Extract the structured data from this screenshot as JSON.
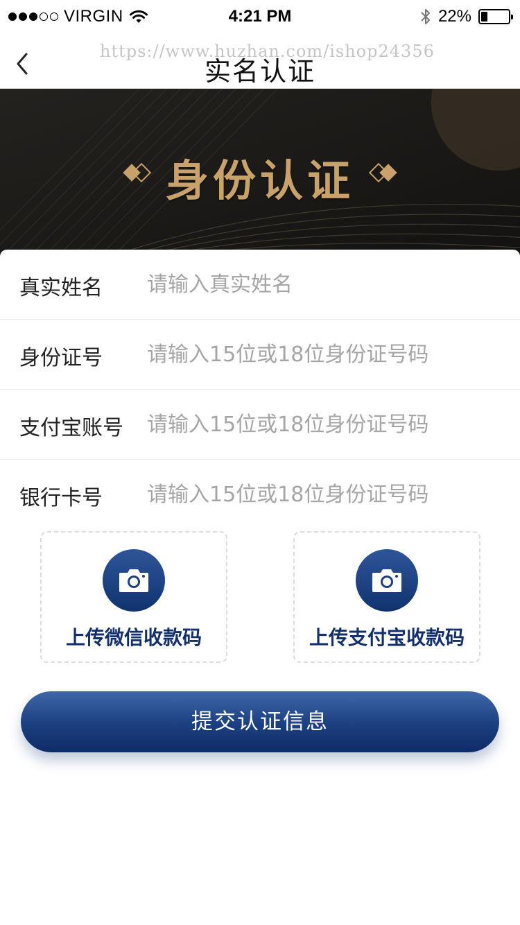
{
  "status_bar": {
    "carrier": "VIRGIN",
    "time": "4:21 PM",
    "battery_percent_text": "22%",
    "battery_level": 0.22,
    "signal_bars_filled": 3,
    "signal_bars_total": 5
  },
  "nav": {
    "title": "实名认证",
    "watermark": "https://www.huzhan.com/ishop24356"
  },
  "banner": {
    "title": "身份认证",
    "accent_color": "#c8a26a"
  },
  "form": {
    "rows": [
      {
        "label": "真实姓名",
        "placeholder": "请输入真实姓名"
      },
      {
        "label": "身份证号",
        "placeholder": "请输入15位或18位身份证号码"
      },
      {
        "label": "支付宝账号",
        "placeholder": "请输入15位或18位身份证号码"
      },
      {
        "label": "银行卡号",
        "placeholder": "请输入15位或18位身份证号码"
      }
    ]
  },
  "uploads": {
    "wechat_label": "上传微信收款码",
    "alipay_label": "上传支付宝收款码"
  },
  "submit": {
    "label": "提交认证信息",
    "color": "#1b3f80"
  },
  "icons": {
    "back": "chevron-left-icon",
    "camera": "camera-icon",
    "wifi": "wifi-icon",
    "bluetooth": "bluetooth-icon",
    "battery": "battery-icon"
  }
}
